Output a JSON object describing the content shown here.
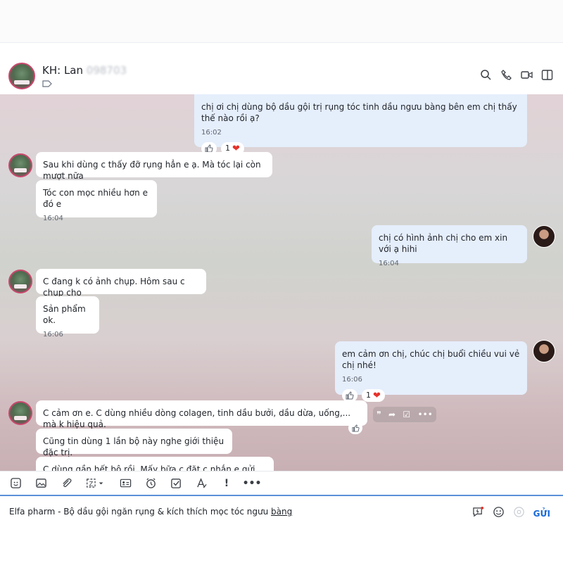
{
  "header": {
    "contact_name": "KH: Lan",
    "contact_phone": "098703"
  },
  "messages": [
    {
      "text": "chị ơi chị dùng bộ dầu gội trị rụng tóc tinh dầu ngưu bàng bên em chị thấy thế nào rồi ạ?",
      "time": "16:02",
      "reaction_count": "1"
    },
    {
      "text": "Sau khi dùng c thấy đỡ rụng hẳn e ạ. Mà tóc lại còn mượt nữa"
    },
    {
      "text": "Tóc con mọc nhiều hơn e đó e",
      "time": "16:04"
    },
    {
      "text": "chị có hình ảnh chị cho em xin với ạ hihi",
      "time": "16:04"
    },
    {
      "text": "C đang k có ảnh chụp. Hôm sau c chụp cho"
    },
    {
      "text": "Sản phẩm ok.",
      "time": "16:06"
    },
    {
      "text": "em cảm ơn chị, chúc chị buổi chiều vui vẻ chị nhé!",
      "time": "16:06",
      "reaction_count": "1"
    },
    {
      "text": "C cảm ơn e.  C dùng nhiều dòng colagen, tinh dầu bưởi, dầu dừa, uống,... mà k hiệu quả."
    },
    {
      "text": "Cũng tin dùng 1 lần bộ này nghe giới thiệu đặc trị."
    },
    {
      "text": "C dùng gần hết bộ rồi. Mấy bữa c đặt c nhắn e gửi thêm cho c"
    }
  ],
  "composer": {
    "text_prefix": "Elfa pharm - Bộ dầu gội ngăn rụng & kích thích mọc tóc ngưu ",
    "text_underlined": "bàng",
    "send_label": "GỬI"
  },
  "toolbar_icons": [
    "sticker-icon",
    "image-icon",
    "attachment-icon",
    "screenshot-icon",
    "contact-card-icon",
    "reminder-icon",
    "task-icon",
    "format-icon",
    "urgent-icon",
    "more-icon"
  ],
  "colors": {
    "accent": "#1a6ad8",
    "out_bubble": "#e5eefb",
    "in_bubble": "#ffffff",
    "heart": "#e5322b"
  }
}
